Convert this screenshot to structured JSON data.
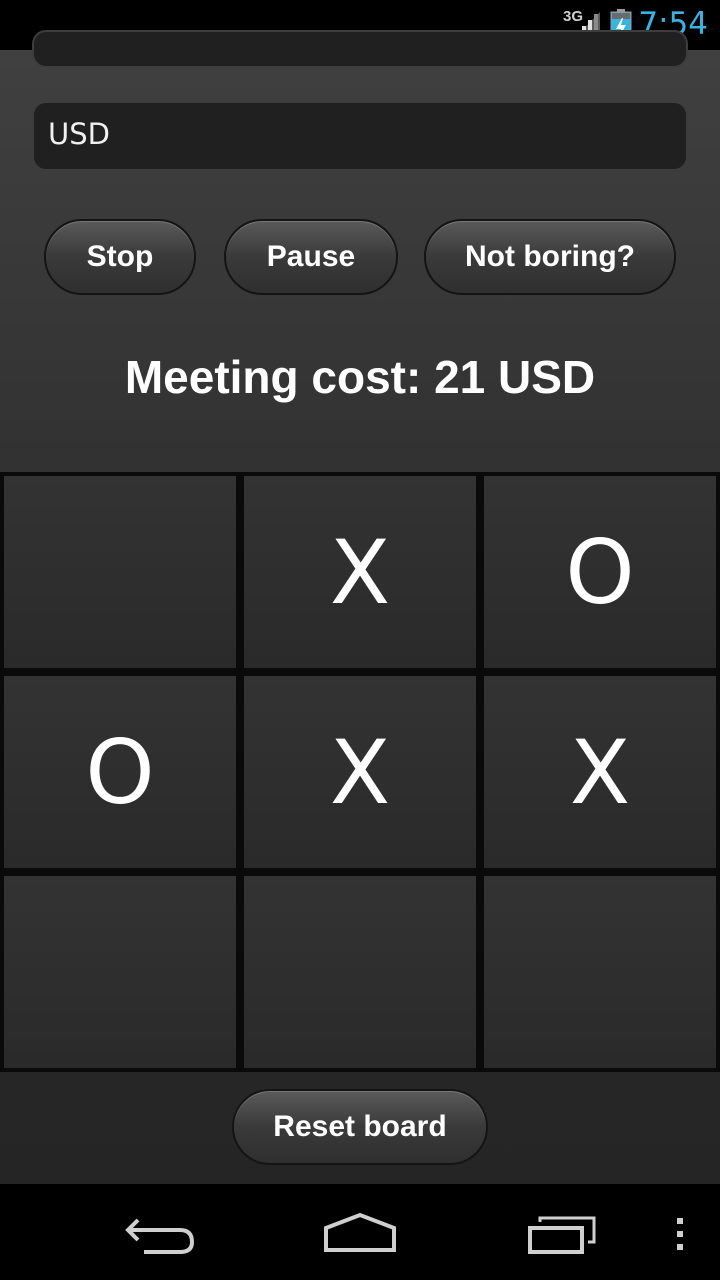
{
  "status_bar": {
    "network": "3G",
    "time": "7:54",
    "icons": [
      "signal-icon",
      "battery-charging-icon"
    ],
    "clock_color": "#33b5e5"
  },
  "currency_field": {
    "value": "USD"
  },
  "buttons": {
    "stop": "Stop",
    "pause": "Pause",
    "not_boring": "Not boring?",
    "reset": "Reset board"
  },
  "meeting_cost": "Meeting cost: 21 USD",
  "board": {
    "cells": [
      "",
      "X",
      "O",
      "O",
      "X",
      "X",
      "",
      "",
      ""
    ]
  },
  "nav_bar": {
    "icons": [
      "back-icon",
      "home-icon",
      "recent-apps-icon",
      "overflow-menu-icon"
    ]
  }
}
